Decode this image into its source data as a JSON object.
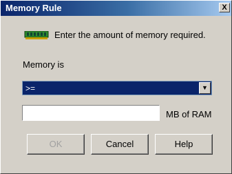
{
  "window": {
    "title": "Memory Rule",
    "close_label": "X"
  },
  "instruction": {
    "text": "Enter the amount of memory required.",
    "icon": "memory-chip-icon"
  },
  "memory_label": "Memory is",
  "operator_select": {
    "value": ">=",
    "arrow": "▼"
  },
  "ram_input": {
    "value": "",
    "unit": "MB of RAM"
  },
  "buttons": {
    "ok": "OK",
    "cancel": "Cancel",
    "help": "Help"
  },
  "colors": {
    "title_bar": "#0a246a",
    "selection": "#0a246a",
    "dialog_bg": "#d4d0c8",
    "chip_green": "#2e8b2e"
  }
}
